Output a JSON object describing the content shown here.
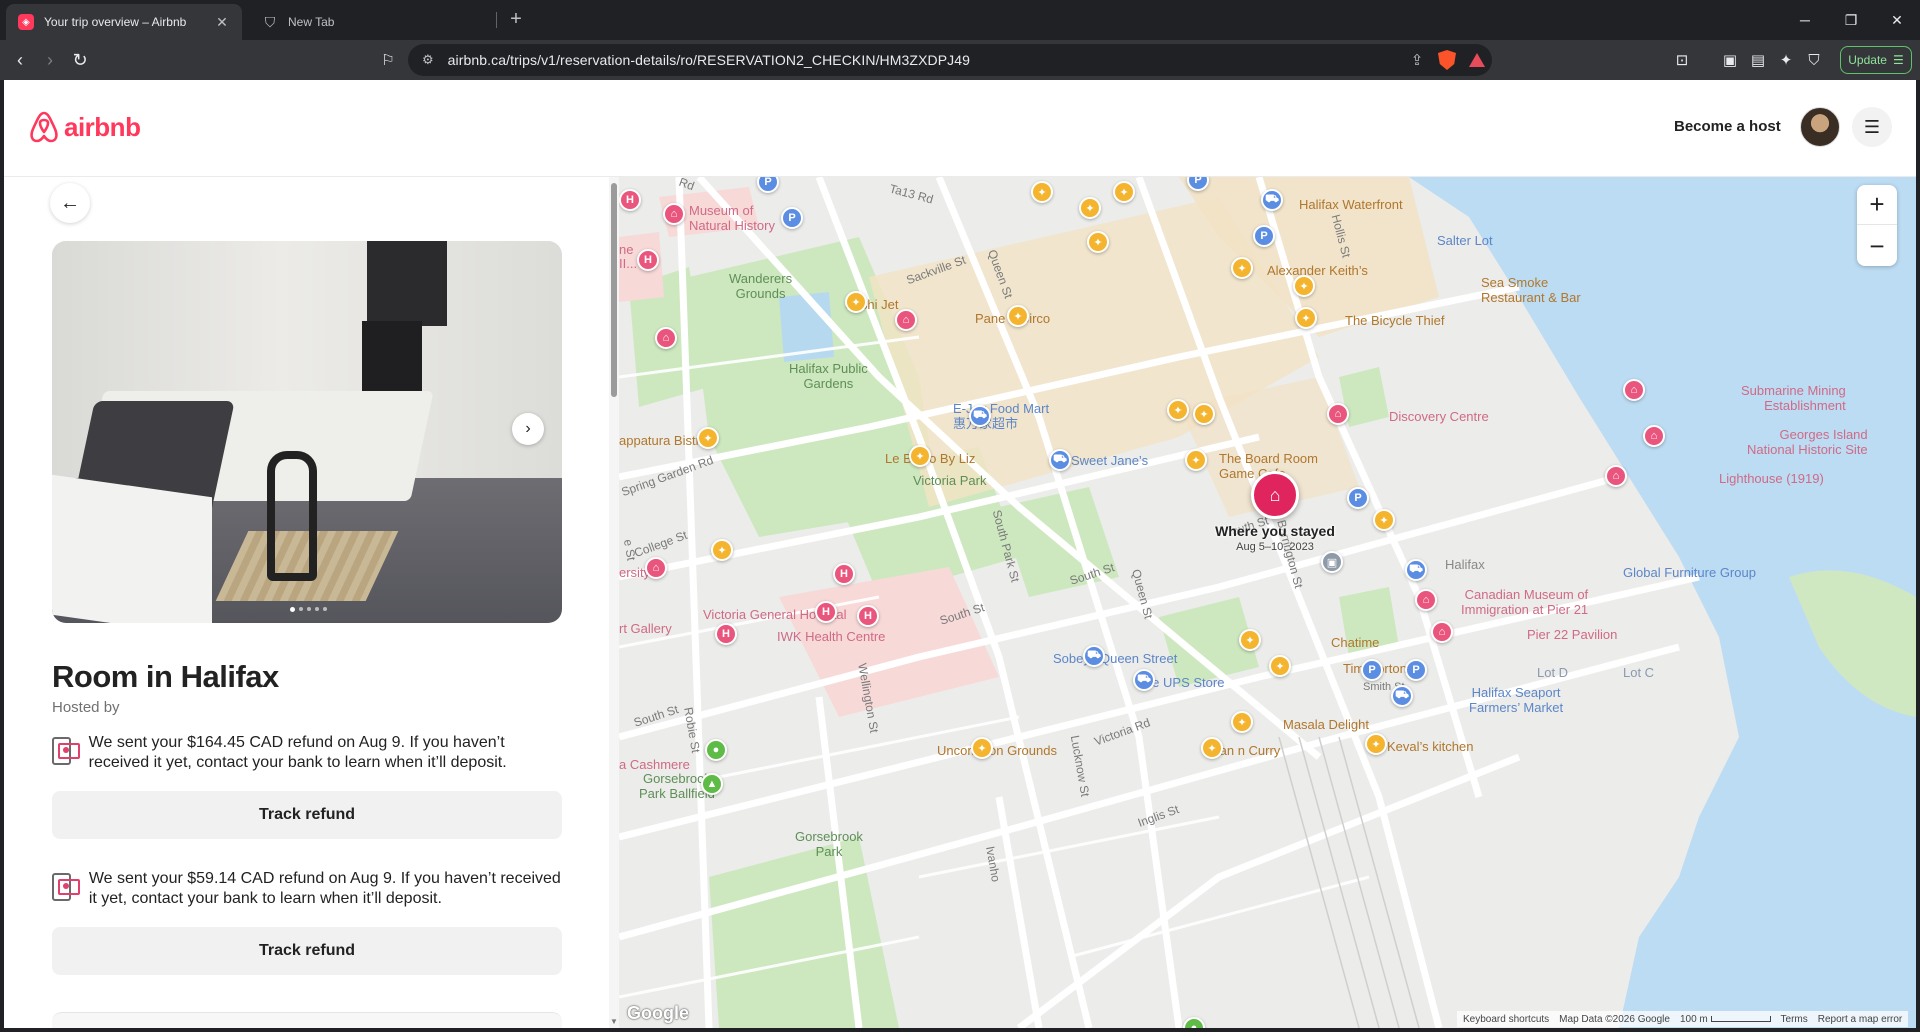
{
  "browser": {
    "tabs": [
      {
        "title": "Your trip overview – Airbnb",
        "active": true
      },
      {
        "title": "New Tab",
        "active": false
      }
    ],
    "url": "airbnb.ca/trips/v1/reservation-details/ro/RESERVATION2_CHECKIN/HM3ZXDPJ49",
    "update_label": "Update",
    "brave_badge": "2"
  },
  "header": {
    "logo_text": "airbnb",
    "become_host": "Become a host"
  },
  "listing": {
    "title": "Room in Halifax",
    "hosted_by": "Hosted by",
    "photo_dots": 5
  },
  "refunds": [
    {
      "text": "We sent your $164.45 CAD refund on Aug 9. If you haven’t received it yet, contact your bank to learn when it’ll deposit.",
      "button": "Track refund"
    },
    {
      "text": "We sent your $59.14 CAD refund on Aug 9. If you haven’t received it yet, contact your bank to learn when it’ll deposit.",
      "button": "Track refund"
    }
  ],
  "map": {
    "stay": {
      "title": "Where you stayed",
      "dates": "Aug 5–10, 2023"
    },
    "labels": {
      "museum": "Museum of\nNatural History",
      "wanderers": "Wanderers\nGrounds",
      "public_gardens": "Halifax Public\nGardens",
      "sushi_jet": "Sushi Jet",
      "pane_circo": "Pane e Circo",
      "ejoy": "E-Joy Food Mart\n惠万家超市",
      "sweet_janes": "Sweet Jane’s",
      "le_bistro": "Le Bistro By Liz",
      "victoria_park": "Victoria Park",
      "pappatura": "appatura Bistro",
      "board_room": "The Board Room\nGame Cafe",
      "halifax_waterfront": "Halifax Waterfront",
      "salter_lot": "Salter Lot",
      "alexander_keiths": "Alexander Keith’s",
      "sea_smoke": "Sea Smoke\nRestaurant & Bar",
      "bicycle_thief": "The Bicycle Thief",
      "discovery_centre": "Discovery Centre",
      "submarine": "Submarine Mining\nEstablishment",
      "georges_island": "Georges Island\nNational Historic Site",
      "lighthouse": "Lighthouse (1919)",
      "halifax": "Halifax",
      "global_furniture": "Global Furniture Group",
      "canadian_museum": "Canadian Museum of\nImmigration at Pier 21",
      "pier22": "Pier 22 Pavilion",
      "chatime": "Chatime",
      "tim_hortons": "Tim Hortons",
      "lot_d": "Lot D",
      "lot_c": "Lot C",
      "seaport": "Halifax Seaport\nFarmers’ Market",
      "victoria_general": "Victoria General Hospital",
      "iwk": "IWK Health Centre",
      "art_gallery": "rt Gallery",
      "ersity": "ersity",
      "sobeys": "Sobeys Queen Street",
      "ups": "The UPS Store",
      "masala": "Masala Delight",
      "kevals": "Keval’s kitchen",
      "naan": "Naan n Curry",
      "uncommon": "Uncommon Grounds",
      "cashmere": "a Cashmere",
      "gorsebrook_ballfield": "Gorsebrook\nPark Ballfield",
      "gorsebrook_park": "Gorsebrook\nPark",
      "ne_ii": "ne\nII..."
    },
    "streets": {
      "sackville": "Sackville St",
      "queen_top": "Queen St",
      "hollis": "Hollis St",
      "spring_garden": "Spring Garden Rd",
      "college": "College St",
      "south_park": "South Park St",
      "south_st_mid": "South St",
      "south_st_right": "South St",
      "south_st_left": "South St",
      "barrington": "Barrington St",
      "queen_mid": "Queen St",
      "robie": "Robie St",
      "wellington": "Wellington St",
      "victoria_rd": "Victoria Rd",
      "lucknow": "Lucknow St",
      "inglis": "Inglis St",
      "smith": "Smith St",
      "ivanhoe": "Ivanho",
      "rd_top": "Rd",
      "bell_rd": "Ta13 Rd",
      "e_st": "e St",
      "south_st_label": "outh St"
    },
    "zoom_in": "+",
    "zoom_out": "−",
    "google": "Google",
    "attribution": {
      "shortcuts": "Keyboard shortcuts",
      "data": "Map Data ©2026 Google",
      "scale": "100 m",
      "terms": "Terms",
      "report": "Report a map error"
    }
  }
}
